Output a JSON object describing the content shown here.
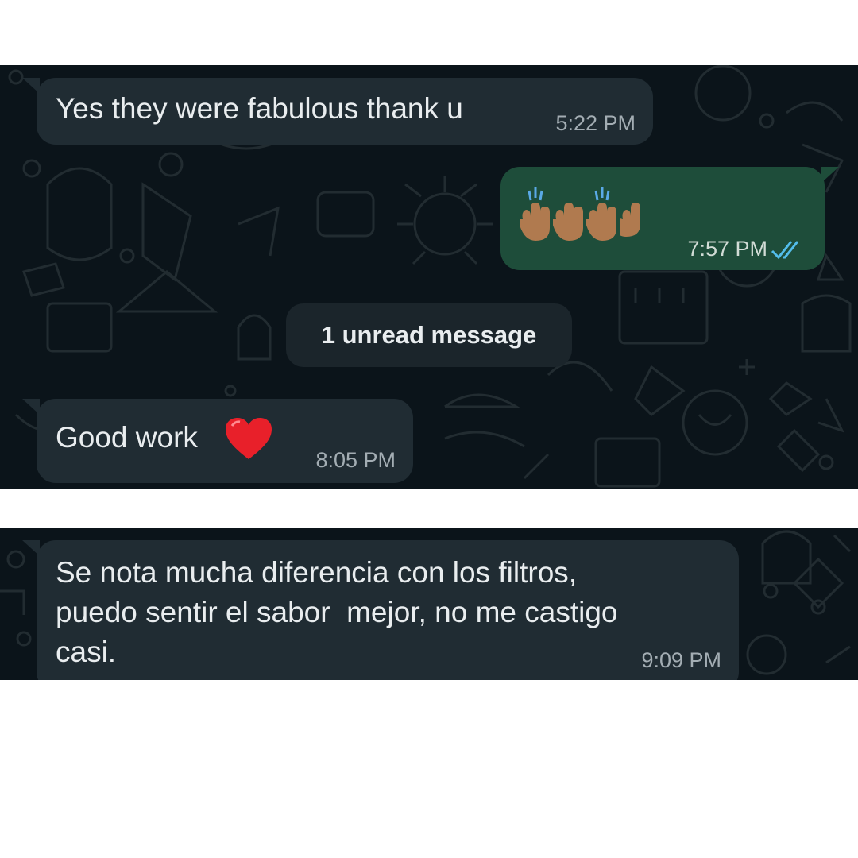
{
  "messages": [
    {
      "id": "m1",
      "direction": "incoming",
      "text": "Yes they were fabulous thank u",
      "time": "5:22 PM"
    },
    {
      "id": "m2",
      "direction": "outgoing",
      "emoji": [
        "raising-hands",
        "raising-hands",
        "raising-hands",
        "raising-hands"
      ],
      "time": "7:57 PM",
      "status": "read",
      "status_icon": "double-check-icon"
    },
    {
      "id": "m3",
      "direction": "incoming",
      "text": "Good work",
      "emoji": "red-heart",
      "time": "8:05 PM"
    },
    {
      "id": "m4",
      "direction": "incoming",
      "text": "Se nota mucha diferencia con los filtros,\npuedo sentir el sabor  mejor, no me castigo\ncasi.",
      "time": "9:09 PM"
    }
  ],
  "unread_divider": {
    "label": "1 unread message"
  },
  "colors": {
    "chat_background": "#0b141a",
    "incoming_bubble": "#202c33",
    "outgoing_bubble": "#1e4d3a",
    "read_checks": "#53bdeb",
    "timestamp": "#a3adb3"
  }
}
